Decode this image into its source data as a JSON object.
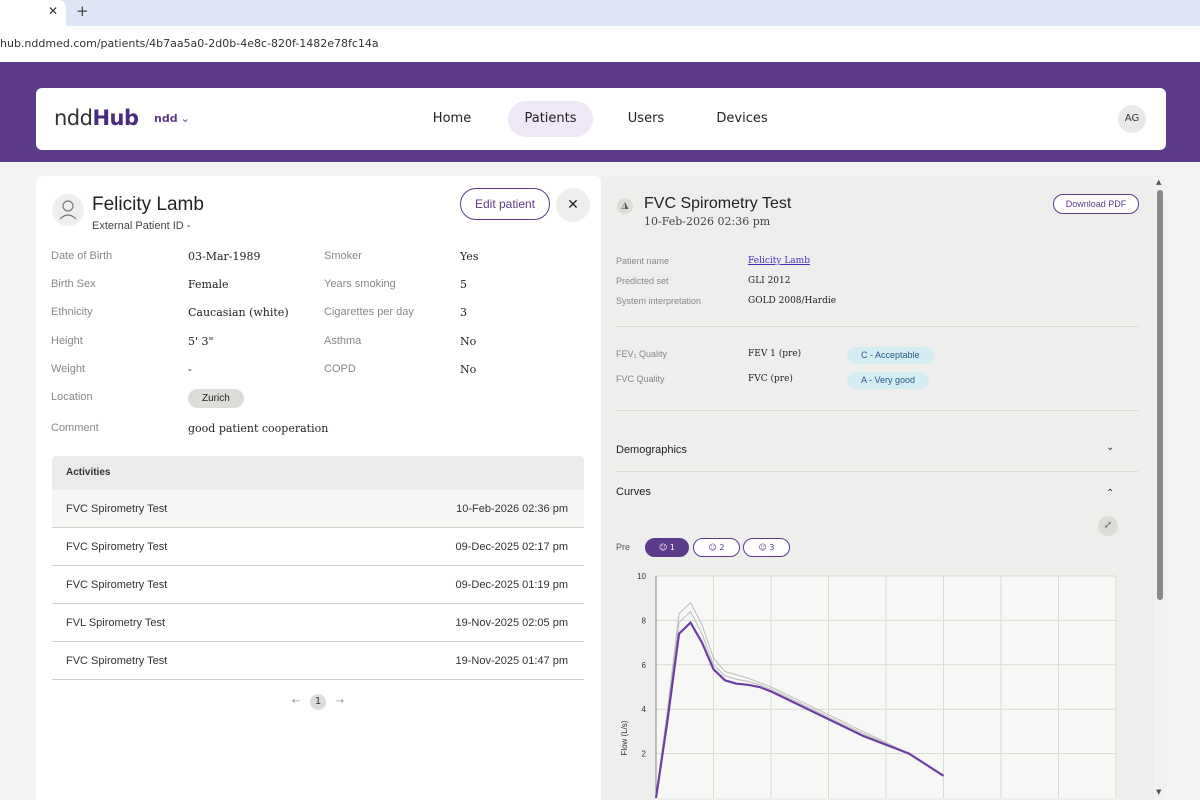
{
  "browser": {
    "close_glyph": "✕",
    "new_tab_glyph": "+",
    "url": "hub.nddmed.com/patients/4b7aa5a0-2d0b-4e8c-820f-1482e78fc14a"
  },
  "header": {
    "logo_ndd": "ndd",
    "logo_hub": "Hub",
    "org": "ndd",
    "org_chevron": "⌄",
    "nav": [
      {
        "label": "Home",
        "active": false
      },
      {
        "label": "Patients",
        "active": true
      },
      {
        "label": "Users",
        "active": false
      },
      {
        "label": "Devices",
        "active": false
      }
    ],
    "avatar_initials": "AG"
  },
  "patient": {
    "name": "Felicity Lamb",
    "external_id": "External Patient ID -",
    "edit_label": "Edit patient",
    "close_glyph": "✕",
    "left_fields": [
      {
        "label": "Date of Birth",
        "value": "03-Mar-1989"
      },
      {
        "label": "Birth Sex",
        "value": "Female"
      },
      {
        "label": "Ethnicity",
        "value": "Caucasian (white)"
      },
      {
        "label": "Height",
        "value": "5' 3\""
      },
      {
        "label": "Weight",
        "value": "-"
      },
      {
        "label": "Location",
        "value": "Zurich"
      },
      {
        "label": "Comment",
        "value": "good patient cooperation"
      }
    ],
    "right_fields": [
      {
        "label": "Smoker",
        "value": "Yes"
      },
      {
        "label": "Years smoking",
        "value": "5"
      },
      {
        "label": "Cigarettes per day",
        "value": "3"
      },
      {
        "label": "Asthma",
        "value": "No"
      },
      {
        "label": "COPD",
        "value": "No"
      }
    ]
  },
  "activities": {
    "header": "Activities",
    "rows": [
      {
        "name": "FVC Spirometry Test",
        "date": "10-Feb-2026 02:36 pm"
      },
      {
        "name": "FVC Spirometry Test",
        "date": "09-Dec-2025 02:17 pm"
      },
      {
        "name": "FVC Spirometry Test",
        "date": "09-Dec-2025 01:19 pm"
      },
      {
        "name": "FVL Spirometry Test",
        "date": "19-Nov-2025 02:05 pm"
      },
      {
        "name": "FVC Spirometry Test",
        "date": "19-Nov-2025 01:47 pm"
      }
    ],
    "pager": {
      "prev": "←",
      "current": "1",
      "next": "→"
    }
  },
  "test": {
    "icon_glyph": "◮",
    "title": "FVC Spirometry Test",
    "date": "10-Feb-2026 02:36 pm",
    "download_label": "Download PDF",
    "info": [
      {
        "label": "Patient name",
        "value": "Felicity Lamb"
      },
      {
        "label": "Predicted set",
        "value": "GLI 2012"
      },
      {
        "label": "System interpretation",
        "value": "GOLD 2008/Hardie"
      }
    ],
    "quality": [
      {
        "label": "FEV₁ Quality",
        "param": "FEV 1 (pre)",
        "badge": "C - Acceptable"
      },
      {
        "label": "FVC Quality",
        "param": "FVC (pre)",
        "badge": "A - Very good"
      }
    ],
    "sections": [
      {
        "label": "Demographics",
        "chevron": "⌄"
      },
      {
        "label": "Curves",
        "chevron": "⌃"
      }
    ],
    "expand_glyph": "⤢",
    "pre_label": "Pre",
    "trials": [
      "1",
      "2",
      "3"
    ],
    "trial_glyph": "☺"
  },
  "colors": {
    "brand_purple": "#5c3b8b",
    "selected_curve": "#6a3fa0",
    "other_curves": "#bdbdbd",
    "badge_bg": "#d4edf3"
  },
  "chart_data": {
    "type": "line",
    "ylabel": "Flow (L/s)",
    "ylim": [
      0,
      10
    ],
    "yticks": [
      "10",
      "8",
      "6",
      "4",
      "2"
    ],
    "series": [
      {
        "trial": "1",
        "selected": true,
        "x": [
          0,
          0.2,
          0.4,
          0.6,
          0.8,
          1.0,
          1.2,
          1.4,
          1.6,
          1.8,
          2.0,
          2.4,
          2.8,
          3.2,
          3.6,
          4.0,
          4.4,
          5.0
        ],
        "y": [
          0,
          3.5,
          7.4,
          7.9,
          7.0,
          5.8,
          5.3,
          5.15,
          5.1,
          5.0,
          4.8,
          4.3,
          3.8,
          3.3,
          2.8,
          2.4,
          2.0,
          1.0
        ]
      },
      {
        "trial": "2",
        "selected": false,
        "x": [
          0,
          0.2,
          0.4,
          0.6,
          0.8,
          1.0,
          1.2,
          1.4,
          1.6,
          1.8,
          2.0,
          2.4,
          2.8,
          3.2,
          3.6,
          4.0,
          4.4,
          5.0
        ],
        "y": [
          0,
          4.0,
          8.3,
          8.8,
          7.8,
          6.3,
          5.7,
          5.55,
          5.4,
          5.2,
          5.0,
          4.5,
          4.0,
          3.5,
          3.0,
          2.5,
          2.0,
          1.0
        ]
      },
      {
        "trial": "3",
        "selected": false,
        "x": [
          0,
          0.2,
          0.4,
          0.6,
          0.8,
          1.0,
          1.2,
          1.4,
          1.6,
          1.8,
          2.0,
          2.4,
          2.8,
          3.2,
          3.6,
          4.0,
          4.4,
          5.0
        ],
        "y": [
          0,
          3.8,
          7.9,
          8.4,
          7.4,
          6.0,
          5.5,
          5.35,
          5.25,
          5.1,
          4.9,
          4.4,
          3.9,
          3.4,
          2.9,
          2.45,
          2.0,
          1.0
        ]
      }
    ]
  }
}
